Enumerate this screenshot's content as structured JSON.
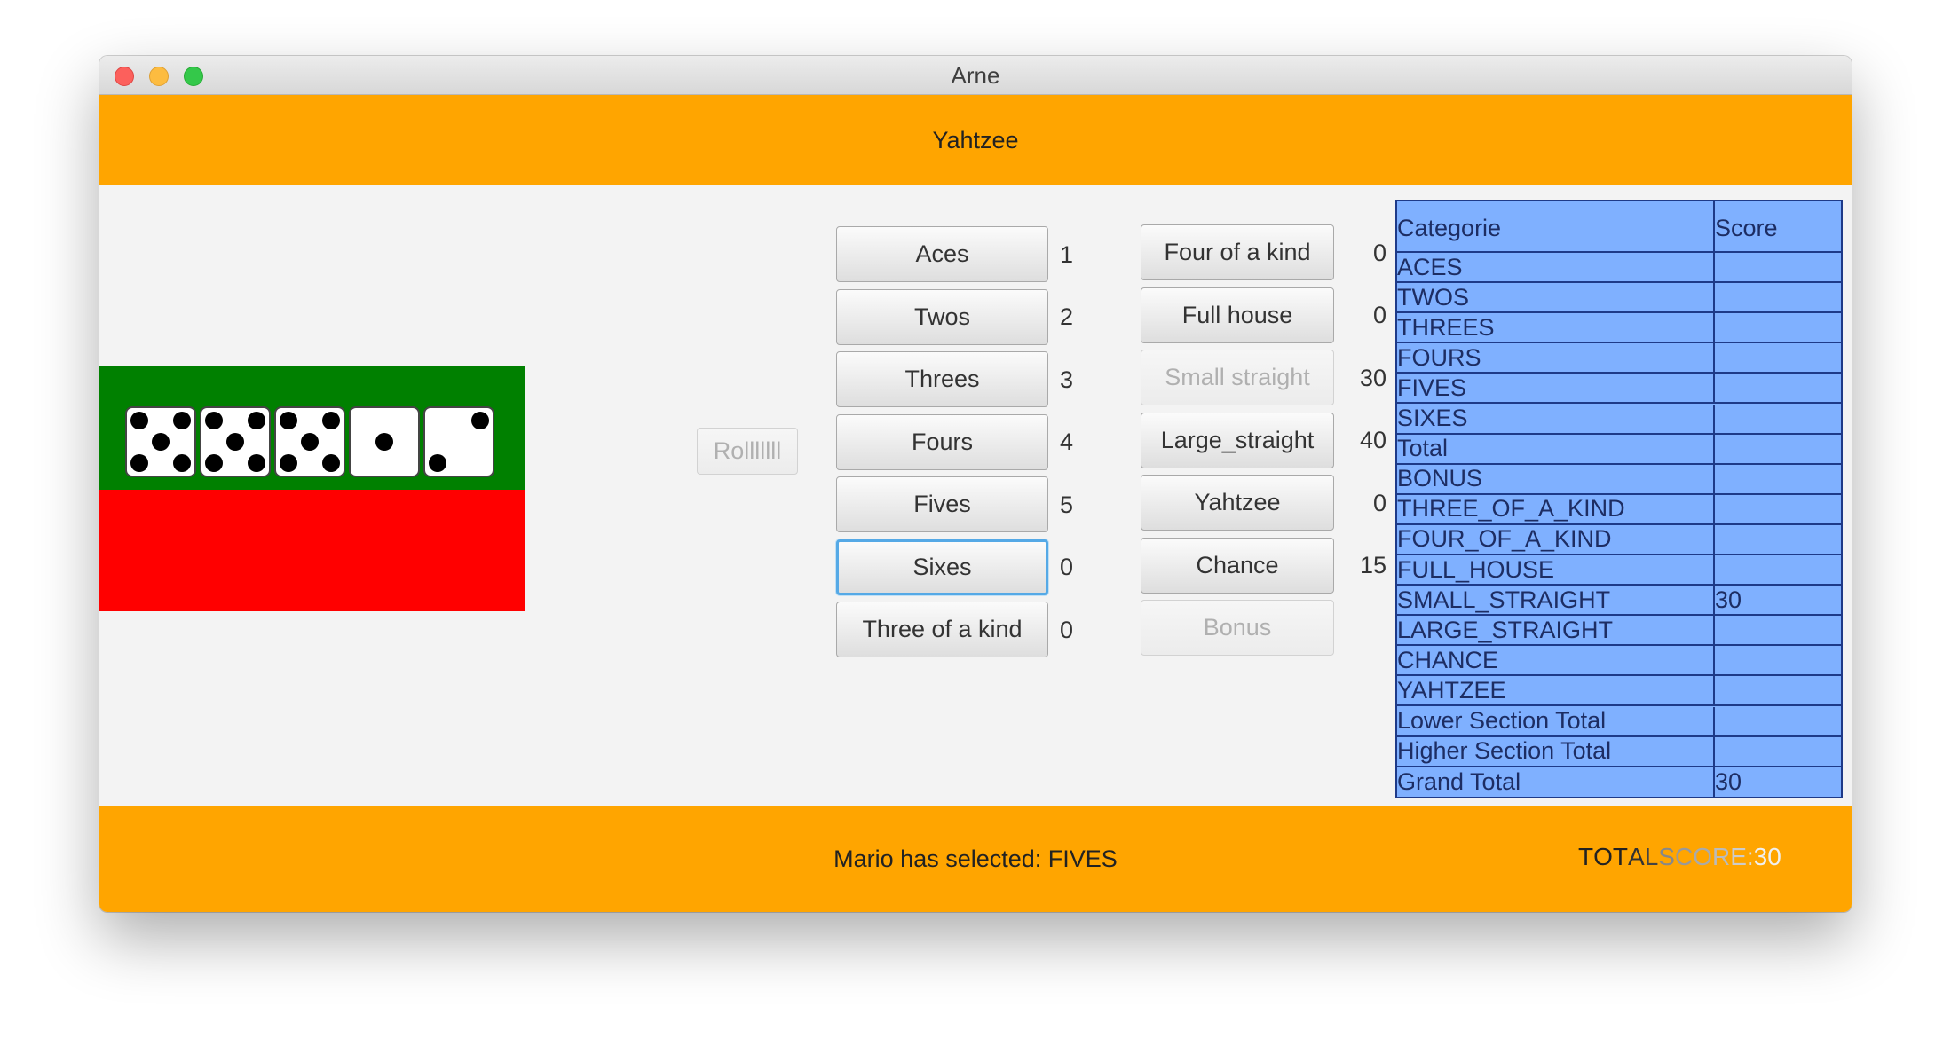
{
  "window": {
    "title": "Arne"
  },
  "header": {
    "title": "Yahtzee"
  },
  "dice": [
    5,
    5,
    5,
    1,
    2
  ],
  "roll_button": {
    "label": "Rolllllll",
    "disabled": true
  },
  "categories_left": [
    {
      "label": "Aces",
      "value": "1"
    },
    {
      "label": "Twos",
      "value": "2"
    },
    {
      "label": "Threes",
      "value": "3"
    },
    {
      "label": "Fours",
      "value": "4"
    },
    {
      "label": "Fives",
      "value": "5"
    },
    {
      "label": "Sixes",
      "value": "0",
      "focused": true
    },
    {
      "label": "Three of a kind",
      "value": "0"
    }
  ],
  "categories_right": [
    {
      "label": "Four of a kind",
      "value": "0"
    },
    {
      "label": "Full house",
      "value": "0"
    },
    {
      "label": "Small straight",
      "value": "30",
      "disabled": true
    },
    {
      "label": "Large_straight",
      "value": "40"
    },
    {
      "label": "Yahtzee",
      "value": "0"
    },
    {
      "label": "Chance",
      "value": "15"
    },
    {
      "label": "Bonus",
      "value": "",
      "disabled": true
    }
  ],
  "score_table": {
    "headers": [
      "Categorie",
      "Score"
    ],
    "rows": [
      {
        "category": "ACES",
        "score": ""
      },
      {
        "category": "TWOS",
        "score": ""
      },
      {
        "category": "THREES",
        "score": ""
      },
      {
        "category": "FOURS",
        "score": ""
      },
      {
        "category": "FIVES",
        "score": ""
      },
      {
        "category": "SIXES",
        "score": ""
      },
      {
        "category": "Total",
        "score": ""
      },
      {
        "category": "BONUS",
        "score": ""
      },
      {
        "category": "THREE_OF_A_KIND",
        "score": ""
      },
      {
        "category": "FOUR_OF_A_KIND",
        "score": ""
      },
      {
        "category": "FULL_HOUSE",
        "score": ""
      },
      {
        "category": "SMALL_STRAIGHT",
        "score": "30"
      },
      {
        "category": "LARGE_STRAIGHT",
        "score": ""
      },
      {
        "category": "CHANCE",
        "score": ""
      },
      {
        "category": "YAHTZEE",
        "score": ""
      },
      {
        "category": "Lower Section Total",
        "score": ""
      },
      {
        "category": "Higher Section Total",
        "score": ""
      },
      {
        "category": "Grand Total",
        "score": "30"
      }
    ]
  },
  "footer": {
    "status": "Mario has selected: FIVES",
    "total_prefix": "TOTAL SCORE:",
    "total_value": "30"
  },
  "colors": {
    "accent": "#ffa500",
    "dice_bg": "#008000",
    "red_panel": "#ff0000",
    "table_bg": "#7fb0ff",
    "table_border": "#1e3a88"
  }
}
